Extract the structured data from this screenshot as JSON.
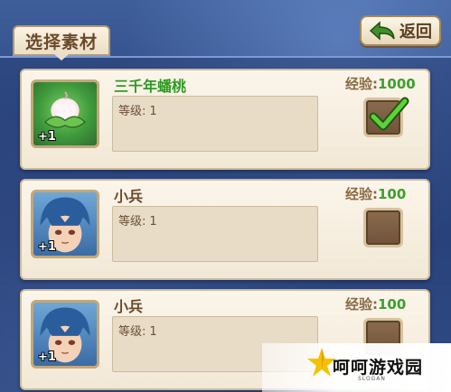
{
  "header": {
    "tab_title": "选择素材",
    "back_label": "返回"
  },
  "materials": [
    {
      "name": "三千年蟠桃",
      "name_color": "#2f9a24",
      "plus": "+1",
      "level_label": "等级:",
      "level_value": "1",
      "exp_label": "经验:",
      "exp_value": "1000",
      "selected": true,
      "icon": "peach-icon"
    },
    {
      "name": "小兵",
      "name_color": "#6b4a2b",
      "plus": "+1",
      "level_label": "等级:",
      "level_value": "1",
      "exp_label": "经验:",
      "exp_value": "100",
      "selected": false,
      "icon": "soldier-portrait"
    },
    {
      "name": "小兵",
      "name_color": "#6b4a2b",
      "plus": "+1",
      "level_label": "等级:",
      "level_value": "1",
      "exp_label": "经验:",
      "exp_value": "100",
      "selected": false,
      "icon": "soldier-portrait"
    }
  ],
  "watermark": {
    "text": "呵呵游戏园",
    "slogan": "SLOGAN"
  }
}
